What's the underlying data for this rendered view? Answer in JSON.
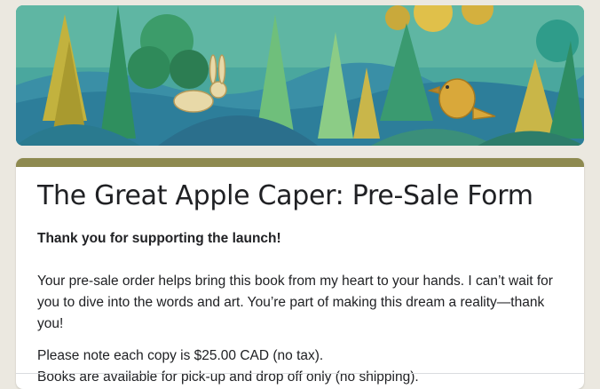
{
  "form": {
    "title": "The Great Apple Caper: Pre-Sale Form",
    "intro_bold": "Thank you for supporting the launch!",
    "paragraph_1": "Your pre-sale order helps bring this book from my heart to your hands. I can’t wait for you to dive into the words and art. You’re part of making this dream a reality—thank you!",
    "paragraph_2_line_1": "Please note each copy is $25.00 CAD (no tax).",
    "paragraph_2_line_2": "Books are available for pick-up and drop off only (no shipping)."
  },
  "colors": {
    "page_background": "#ebe8e0",
    "card_accent": "#8e8a50",
    "banner_teal": "#3fa39a"
  },
  "banner": {
    "illustration": "forest scene with trees, a rabbit and a yellow bird"
  }
}
